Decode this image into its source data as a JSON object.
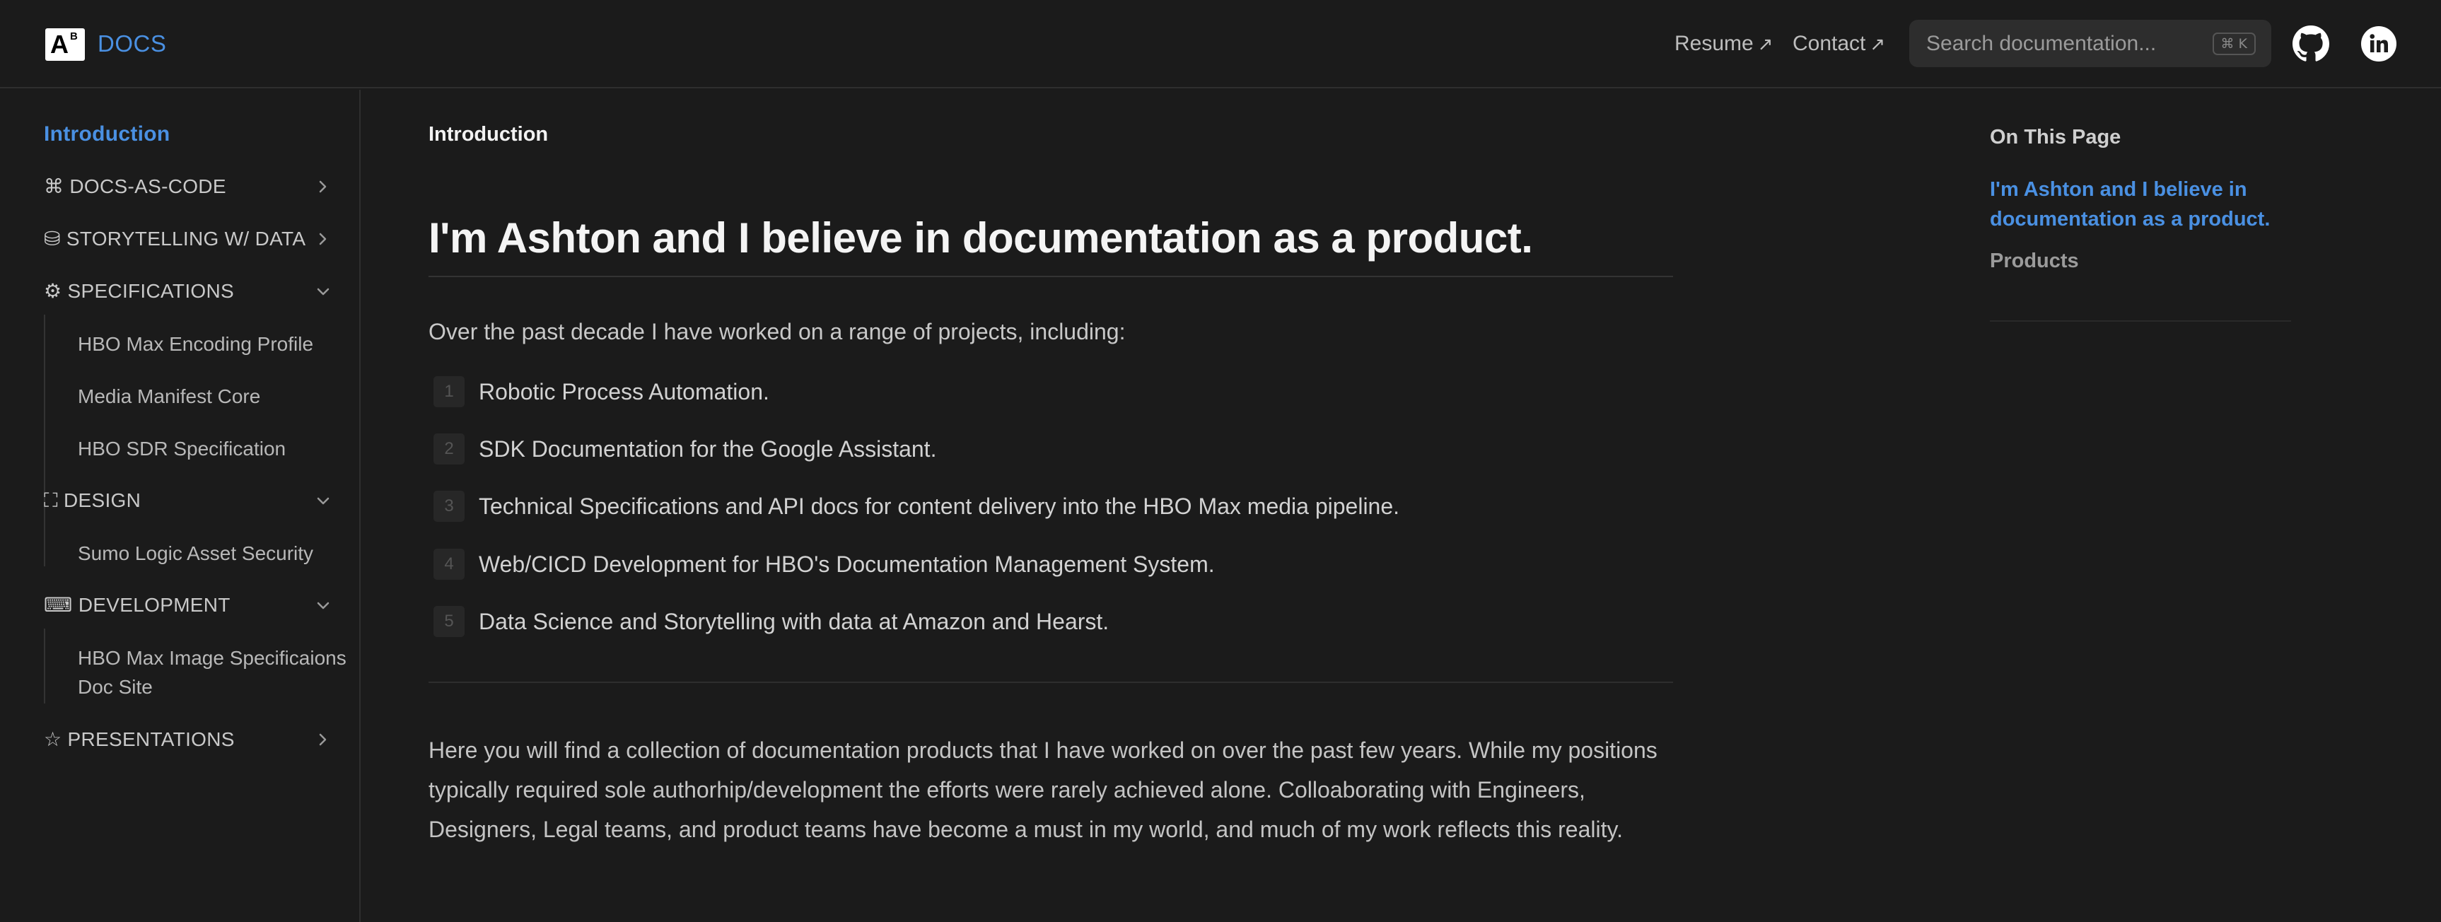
{
  "header": {
    "logo_main": "A",
    "logo_sup": "B",
    "brand": "DOCS",
    "links": [
      {
        "label": "Resume",
        "arrow": "↗"
      },
      {
        "label": "Contact",
        "arrow": "↗"
      }
    ],
    "search": {
      "placeholder": "Search documentation...",
      "shortcut": "⌘ K"
    },
    "icons": [
      "github-icon",
      "linkedin-icon"
    ]
  },
  "sidebar": {
    "active": "Introduction",
    "groups": [
      {
        "icon": "⌘",
        "label": "DOCS-AS-CODE",
        "expanded": false
      },
      {
        "icon": "⛁",
        "label": "STORYTELLING W/ DATA",
        "expanded": false
      },
      {
        "icon": "⚙",
        "label": "SPECIFICATIONS",
        "expanded": true,
        "children": [
          "HBO Max Encoding Profile",
          "Media Manifest Core",
          "HBO SDR Specification"
        ]
      },
      {
        "icon": "⛶",
        "label": "DESIGN",
        "expanded": true,
        "children": [
          "Sumo Logic Asset Security"
        ]
      },
      {
        "icon": "⌨",
        "label": "DEVELOPMENT",
        "expanded": true,
        "children": [
          "HBO Max Image Specificaions Doc Site"
        ]
      },
      {
        "icon": "☆",
        "label": "PRESENTATIONS",
        "expanded": false
      }
    ]
  },
  "main": {
    "breadcrumb": "Introduction",
    "title": "I'm Ashton and I believe in documentation as a product.",
    "intro": "Over the past decade I have worked on a range of projects, including:",
    "list": [
      {
        "num": "1",
        "text": "Robotic Process Automation."
      },
      {
        "num": "2",
        "text": "SDK Documentation for the Google Assistant."
      },
      {
        "num": "3",
        "text": "Technical Specifications and API docs for content delivery into the HBO Max media pipeline."
      },
      {
        "num": "4",
        "text": "Web/CICD Development for HBO's Documentation Management System."
      },
      {
        "num": "5",
        "text": "Data Science and Storytelling with data at Amazon and Hearst."
      }
    ],
    "paragraph": "Here you will find a collection of documentation products that I have worked on over the past few years. While my positions typically required sole authorhip/development the efforts were rarely achieved alone. Colloaborating with Engineers, Designers, Legal teams, and product teams have become a must in my world, and much of my work reflects this reality."
  },
  "toc": {
    "title": "On This Page",
    "active": "I'm Ashton and I believe in documentation as a product.",
    "items": [
      "Products"
    ]
  },
  "colors": {
    "accent": "#4a90e2",
    "background": "#1b1b1b",
    "surface": "#2d2d2d"
  }
}
